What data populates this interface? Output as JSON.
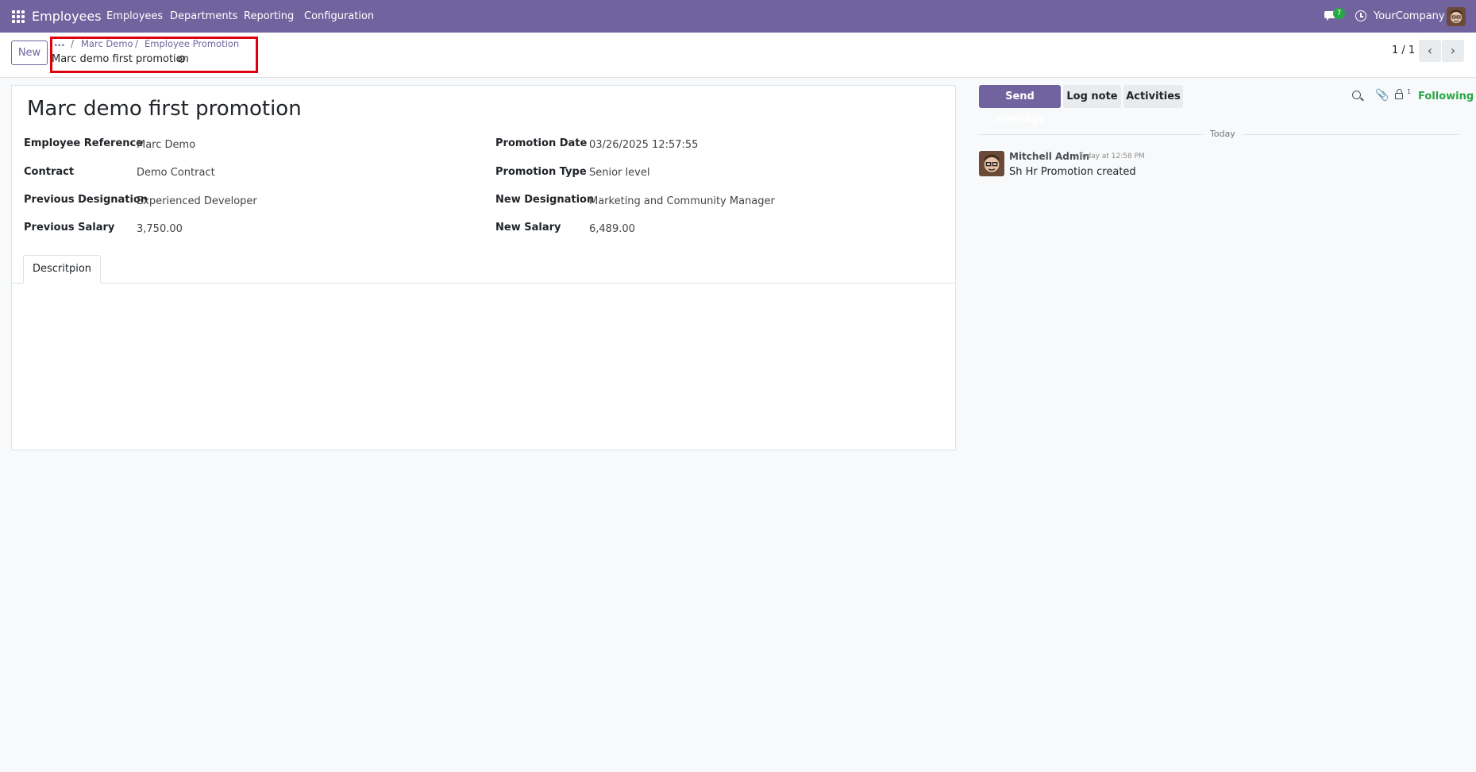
{
  "navbar": {
    "app_name": "Employees",
    "menu": [
      "Employees",
      "Departments",
      "Reporting",
      "Configuration"
    ],
    "chat_badge": "7",
    "company": "YourCompany"
  },
  "control_panel": {
    "new_button": "New",
    "breadcrumb": {
      "ellipsis": "...",
      "separator": "/",
      "items": [
        "Marc Demo",
        "Employee Promotion"
      ]
    },
    "record_title": "Marc demo first promotion",
    "pager": "1 / 1"
  },
  "form": {
    "title": "Marc demo first promotion",
    "left_fields": [
      {
        "label": "Employee Reference",
        "value": "Marc Demo"
      },
      {
        "label": "Contract",
        "value": "Demo Contract"
      },
      {
        "label": "Previous Designation",
        "value": "Experienced Developer"
      },
      {
        "label": "Previous Salary",
        "value": "3,750.00"
      }
    ],
    "right_fields": [
      {
        "label": "Promotion Date",
        "value": "03/26/2025 12:57:55"
      },
      {
        "label": "Promotion Type",
        "value": "Senior level"
      },
      {
        "label": "New Designation",
        "value": "Marketing and Community Manager"
      },
      {
        "label": "New Salary",
        "value": "6,489.00"
      }
    ],
    "tabs": [
      "Descritpion"
    ]
  },
  "chatter": {
    "send_message": "Send message",
    "log_note": "Log note",
    "activities": "Activities",
    "follower_count": "1",
    "following": "Following",
    "date_separator": "Today",
    "messages": [
      {
        "author": "Mitchell Admin",
        "time": "Today at 12:58 PM",
        "body": "Sh Hr Promotion created"
      }
    ]
  },
  "colors": {
    "brand": "#71639e",
    "following": "#28a745",
    "highlight": "#e0000d"
  }
}
